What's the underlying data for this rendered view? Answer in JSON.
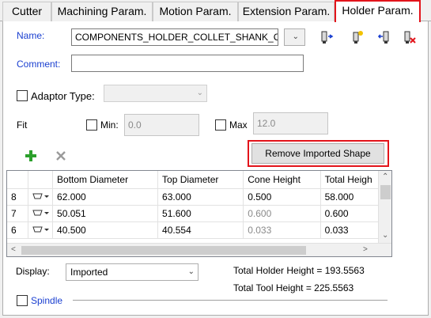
{
  "tabs": [
    {
      "label": "Cutter"
    },
    {
      "label": "Machining Param."
    },
    {
      "label": "Motion Param."
    },
    {
      "label": "Extension Param."
    },
    {
      "label": "Holder Param."
    }
  ],
  "name": {
    "label": "Name:",
    "value": "COMPONENTS_HOLDER_COLLET_SHANK_CU"
  },
  "comment": {
    "label": "Comment:",
    "value": ""
  },
  "adaptor": {
    "label": "Adaptor Type:",
    "value": ""
  },
  "fit": {
    "label": "Fit",
    "min_label": "Min:",
    "min_value": "0.0",
    "max_label": "Max",
    "max_value": "12.0"
  },
  "remove_button": {
    "label": "Remove Imported Shape"
  },
  "table": {
    "columns": [
      "",
      "",
      "Bottom Diameter",
      "Top Diameter",
      "Cone Height",
      "Total Heigh"
    ],
    "rows": [
      {
        "idx": "8",
        "bottom": "62.000",
        "top": "63.000",
        "cone": "0.500",
        "total": "58.000",
        "cone_grey": false
      },
      {
        "idx": "7",
        "bottom": "50.051",
        "top": "51.600",
        "cone": "0.600",
        "total": "0.600",
        "cone_grey": true
      },
      {
        "idx": "6",
        "bottom": "40.500",
        "top": "40.554",
        "cone": "0.033",
        "total": "0.033",
        "cone_grey": true
      }
    ]
  },
  "display": {
    "label": "Display:",
    "value": "Imported"
  },
  "totals": {
    "holder": "Total Holder Height = 193.5563",
    "tool": "Total Tool Height = 225.5563"
  },
  "spindle": {
    "label": "Spindle"
  },
  "colors": {
    "accent_red": "#e3141b",
    "label_blue": "#1a3fd0",
    "add_green": "#2ca02c"
  },
  "icons": [
    "tool-import-icon",
    "tool-new-icon",
    "tool-export-icon",
    "tool-delete-icon",
    "add-icon",
    "remove-icon"
  ]
}
